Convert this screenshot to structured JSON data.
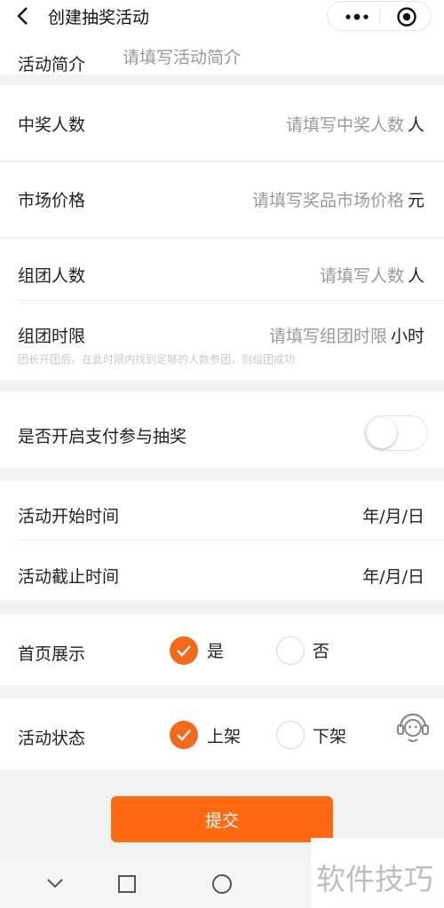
{
  "header": {
    "title": "创建抽奖活动"
  },
  "fields": {
    "intro": {
      "label": "活动简介",
      "placeholder": "请填写活动简介"
    },
    "winners": {
      "label": "中奖人数",
      "placeholder": "请填写中奖人数",
      "unit": "人"
    },
    "market_price": {
      "label": "市场价格",
      "placeholder": "请填写奖品市场价格",
      "unit": "元"
    },
    "group_size": {
      "label": "组团人数",
      "placeholder": "请填写人数",
      "unit": "人"
    },
    "group_limit": {
      "label": "组团时限",
      "placeholder": "请填写组团时限",
      "unit": "小时",
      "hint": "团长开团后，在此时限内找到足够的人数参团，则组团成功"
    },
    "pay_to_join": {
      "label": "是否开启支付参与抽奖",
      "enabled": false
    },
    "start_time": {
      "label": "活动开始时间",
      "value": "年/月/日"
    },
    "end_time": {
      "label": "活动截止时间",
      "value": "年/月/日"
    },
    "homepage": {
      "label": "首页展示",
      "options": [
        "是",
        "否"
      ],
      "selected": "是"
    },
    "status": {
      "label": "活动状态",
      "options": [
        "上架",
        "下架"
      ],
      "selected": "上架"
    }
  },
  "submit_label": "提交",
  "watermark": "软件技巧",
  "colors": {
    "accent": "#f26a1b",
    "button": "#ff6a10"
  }
}
